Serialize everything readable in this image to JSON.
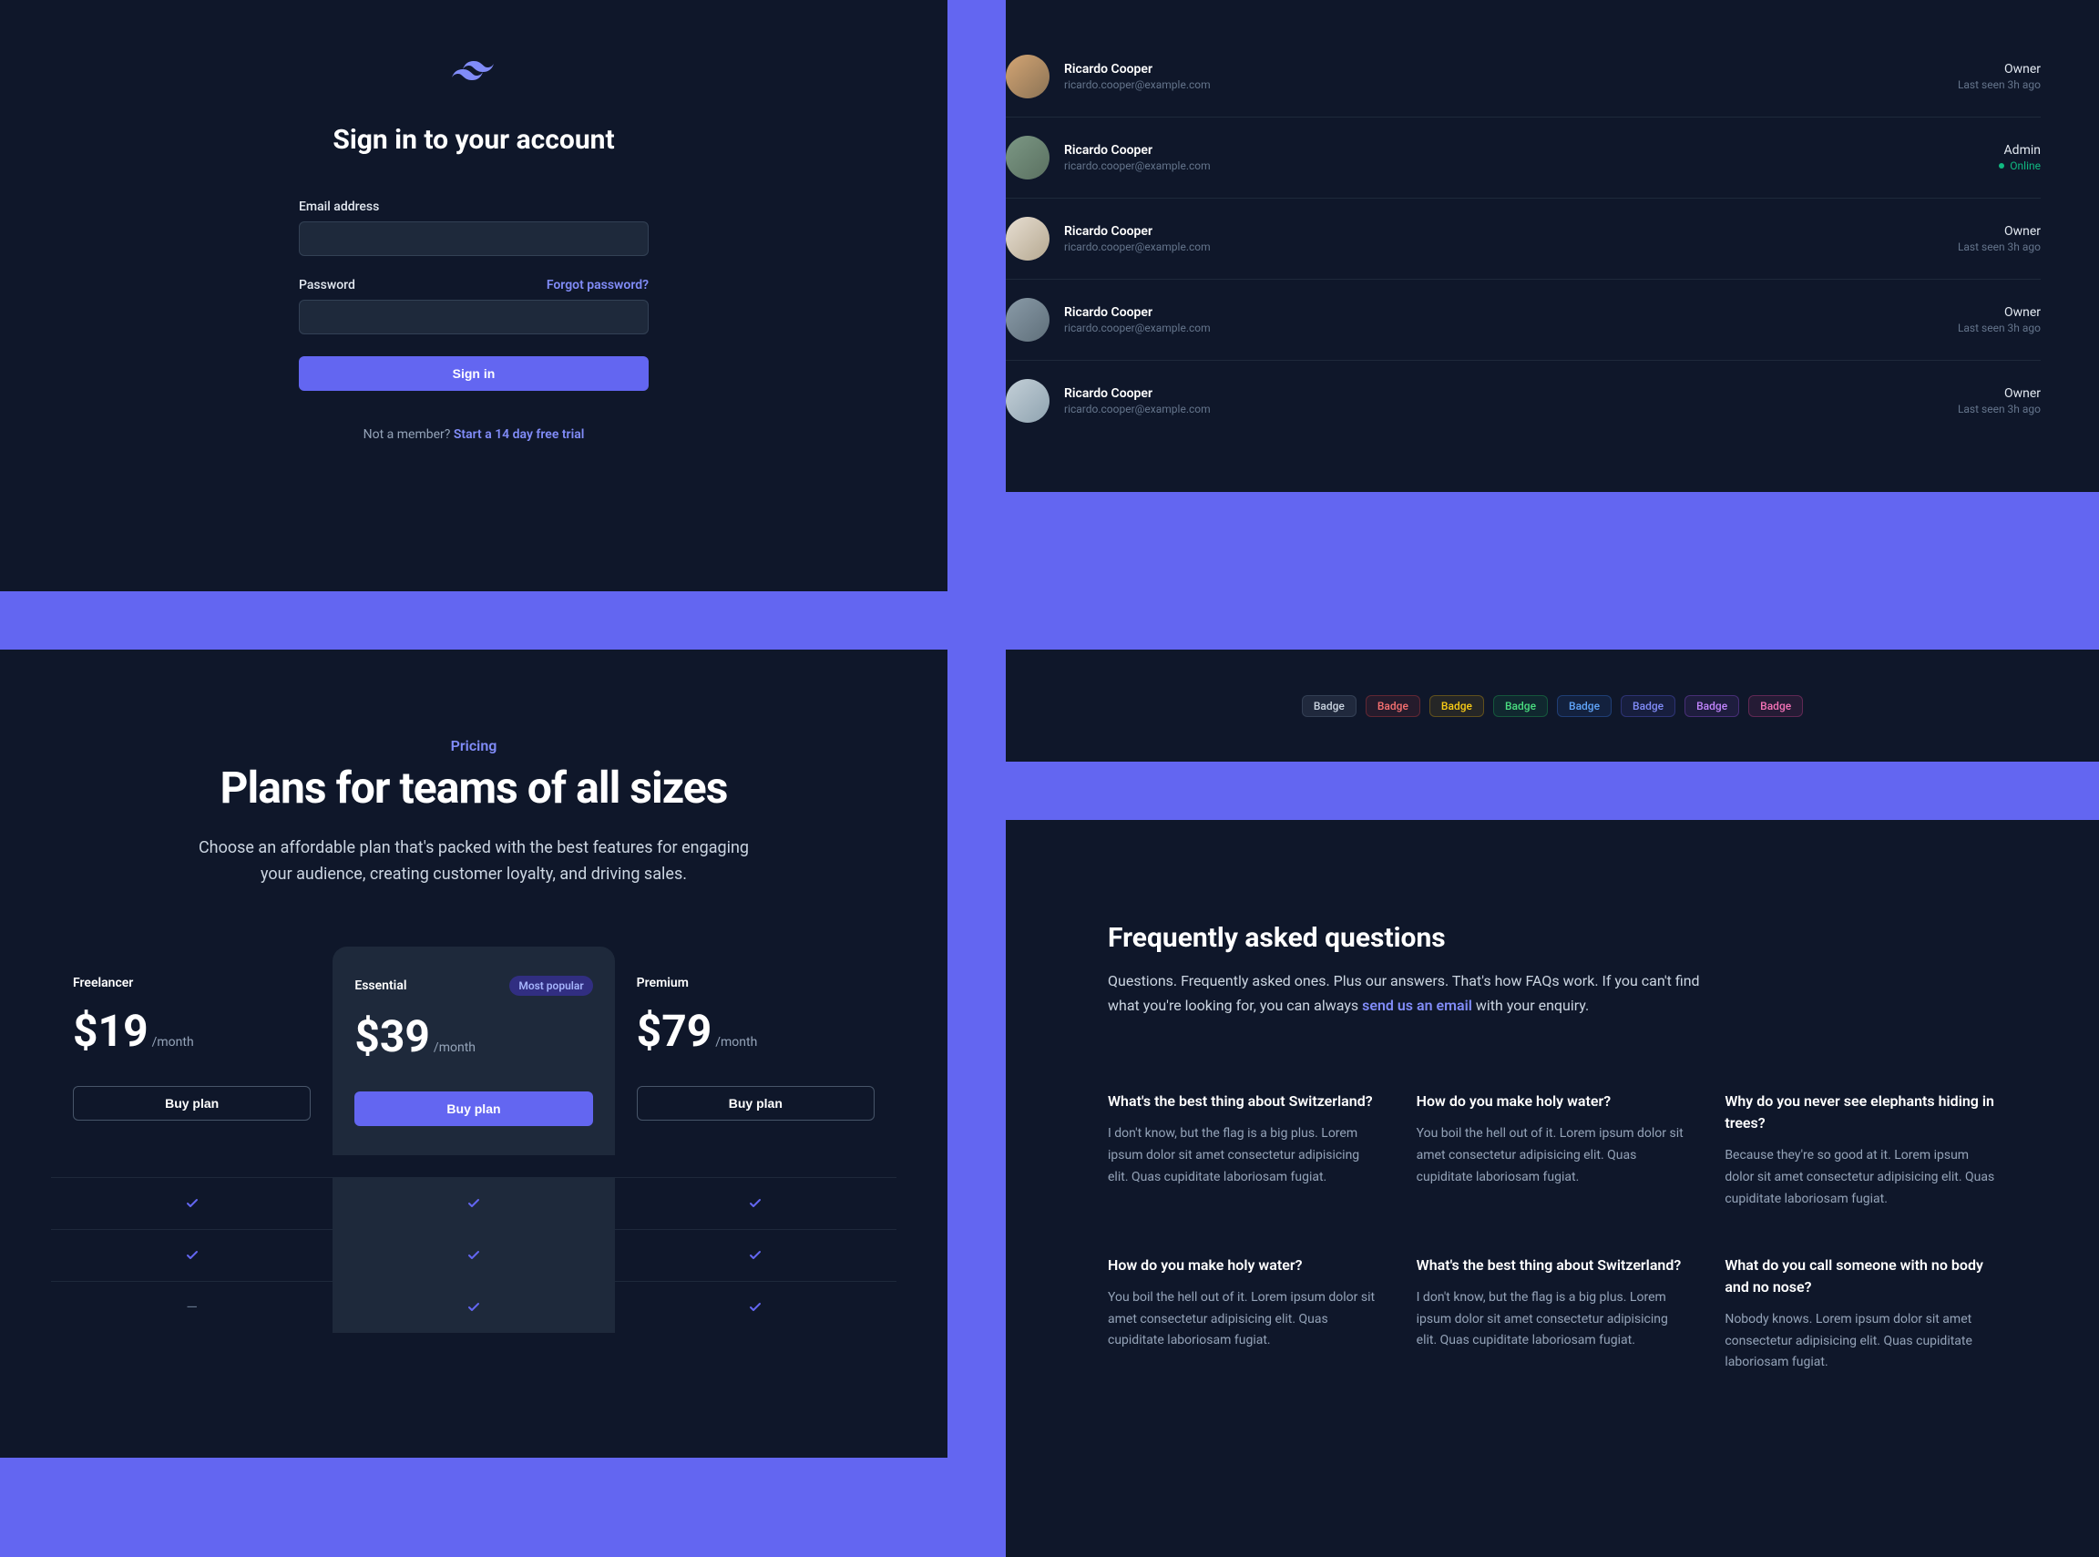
{
  "signin": {
    "title": "Sign in to your account",
    "email_label": "Email address",
    "password_label": "Password",
    "forgot_label": "Forgot password?",
    "submit_label": "Sign in",
    "not_member": "Not a member? ",
    "trial_link": "Start a 14 day free trial"
  },
  "users": [
    {
      "name": "Ricardo Cooper",
      "email": "ricardo.cooper@example.com",
      "role": "Owner",
      "status": "Last seen 3h ago",
      "online": false
    },
    {
      "name": "Ricardo Cooper",
      "email": "ricardo.cooper@example.com",
      "role": "Admin",
      "status": "Online",
      "online": true
    },
    {
      "name": "Ricardo Cooper",
      "email": "ricardo.cooper@example.com",
      "role": "Owner",
      "status": "Last seen 3h ago",
      "online": false
    },
    {
      "name": "Ricardo Cooper",
      "email": "ricardo.cooper@example.com",
      "role": "Owner",
      "status": "Last seen 3h ago",
      "online": false
    },
    {
      "name": "Ricardo Cooper",
      "email": "ricardo.cooper@example.com",
      "role": "Owner",
      "status": "Last seen 3h ago",
      "online": false
    }
  ],
  "badges": [
    {
      "label": "Badge",
      "color": "gray"
    },
    {
      "label": "Badge",
      "color": "red"
    },
    {
      "label": "Badge",
      "color": "yellow"
    },
    {
      "label": "Badge",
      "color": "green"
    },
    {
      "label": "Badge",
      "color": "blue"
    },
    {
      "label": "Badge",
      "color": "indigo"
    },
    {
      "label": "Badge",
      "color": "purple"
    },
    {
      "label": "Badge",
      "color": "pink"
    }
  ],
  "pricing": {
    "eyebrow": "Pricing",
    "title": "Plans for teams of all sizes",
    "subtitle": "Choose an affordable plan that's packed with the best features for engaging your audience, creating customer loyalty, and driving sales.",
    "plans": [
      {
        "name": "Freelancer",
        "price": "$19",
        "unit": "/month",
        "buy": "Buy plan",
        "featured": false
      },
      {
        "name": "Essential",
        "price": "$39",
        "unit": "/month",
        "buy": "Buy plan",
        "featured": true,
        "popular": "Most popular"
      },
      {
        "name": "Premium",
        "price": "$79",
        "unit": "/month",
        "buy": "Buy plan",
        "featured": false
      }
    ],
    "rows": [
      [
        "check",
        "check",
        "check"
      ],
      [
        "check",
        "check",
        "check"
      ],
      [
        "dash",
        "check",
        "check"
      ]
    ]
  },
  "faq": {
    "title": "Frequently asked questions",
    "intro_1": "Questions. Frequently asked ones. Plus our answers. That's how FAQs work. If you can't find what you're looking for, you can always ",
    "intro_link": "send us an email",
    "intro_2": " with your enquiry.",
    "items": [
      {
        "q": "What's the best thing about Switzerland?",
        "a": "I don't know, but the flag is a big plus. Lorem ipsum dolor sit amet consectetur adipisicing elit. Quas cupiditate laboriosam fugiat."
      },
      {
        "q": "How do you make holy water?",
        "a": "You boil the hell out of it. Lorem ipsum dolor sit amet consectetur adipisicing elit. Quas cupiditate laboriosam fugiat."
      },
      {
        "q": "Why do you never see elephants hiding in trees?",
        "a": "Because they're so good at it. Lorem ipsum dolor sit amet consectetur adipisicing elit. Quas cupiditate laboriosam fugiat."
      },
      {
        "q": "How do you make holy water?",
        "a": "You boil the hell out of it. Lorem ipsum dolor sit amet consectetur adipisicing elit. Quas cupiditate laboriosam fugiat."
      },
      {
        "q": "What's the best thing about Switzerland?",
        "a": "I don't know, but the flag is a big plus. Lorem ipsum dolor sit amet consectetur adipisicing elit. Quas cupiditate laboriosam fugiat."
      },
      {
        "q": "What do you call someone with no body and no nose?",
        "a": "Nobody knows. Lorem ipsum dolor sit amet consectetur adipisicing elit. Quas cupiditate laboriosam fugiat."
      }
    ]
  }
}
